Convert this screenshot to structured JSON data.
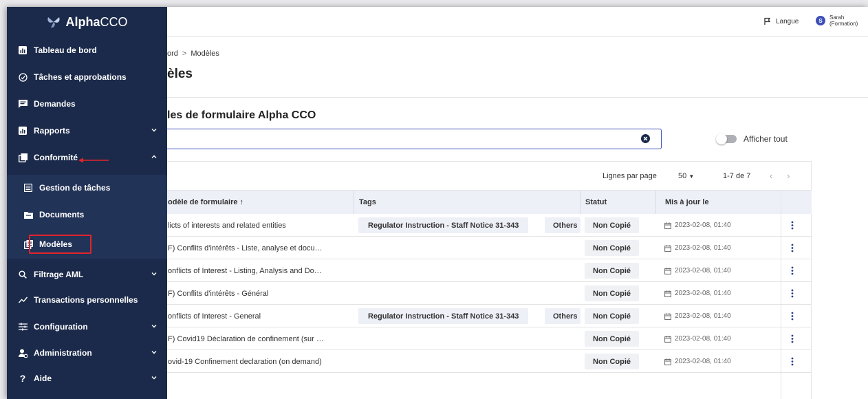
{
  "app": {
    "logo_bold": "Alpha",
    "logo_light": "CCO"
  },
  "header": {
    "language_label": "Langue",
    "user_initial": "S",
    "user_name_line1": "Sarah",
    "user_name_line2": "(Formation)"
  },
  "sidebar": {
    "items": [
      {
        "label": "Tableau de bord",
        "icon": "bar-chart-icon"
      },
      {
        "label": "Tâches et approbations",
        "icon": "check-circle-icon"
      },
      {
        "label": "Demandes",
        "icon": "message-icon"
      },
      {
        "label": "Rapports",
        "icon": "bar-chart-icon",
        "expandable": true
      },
      {
        "label": "Conformité",
        "icon": "copy-icon",
        "expanded": true
      },
      {
        "label": "Gestion de tâches",
        "icon": "list-icon"
      },
      {
        "label": "Documents",
        "icon": "folder-icon"
      },
      {
        "label": "Modèles",
        "icon": "template-icon",
        "active": true
      },
      {
        "label": "Filtrage AML",
        "icon": "search-icon",
        "expandable": true
      },
      {
        "label": "Transactions personnelles",
        "icon": "trend-icon"
      },
      {
        "label": "Configuration",
        "icon": "sliders-icon",
        "expandable": true
      },
      {
        "label": "Administration",
        "icon": "user-gear-icon",
        "expandable": true
      },
      {
        "label": "Aide",
        "icon": "question-icon",
        "expandable": true
      }
    ]
  },
  "breadcrumb": {
    "parent": "ord",
    "separator": ">",
    "current": "Modèles"
  },
  "page": {
    "title": "èles",
    "section_title": "les de formulaire Alpha CCO"
  },
  "search": {
    "value": "",
    "placeholder": ""
  },
  "toggle": {
    "label": "Afficher tout",
    "on": false
  },
  "pager": {
    "rows_per_page_label": "Lignes par page",
    "rows_per_page_value": "50",
    "range": "1-7 de 7"
  },
  "table": {
    "headers": {
      "name": "odèle de formulaire ↑",
      "tags": "Tags",
      "status": "Statut",
      "updated": "Mis à jour le"
    },
    "rows": [
      {
        "name": "licts of interests and related entities",
        "tag": "Regulator Instruction - Staff Notice 31-343",
        "tag2": "Others",
        "status": "Non Copié",
        "date": "2023-02-08, 01:40"
      },
      {
        "name": "F) Conflits d'intérêts - Liste, analyse et docu…",
        "tag": "",
        "tag2": "",
        "status": "Non Copié",
        "date": "2023-02-08, 01:40"
      },
      {
        "name": "onflicts of Interest - Listing, Analysis and Do…",
        "tag": "",
        "tag2": "",
        "status": "Non Copié",
        "date": "2023-02-08, 01:40"
      },
      {
        "name": "F) Conflits d'intérêts - Général",
        "tag": "",
        "tag2": "",
        "status": "Non Copié",
        "date": "2023-02-08, 01:40"
      },
      {
        "name": "onflicts of Interest - General",
        "tag": "Regulator Instruction - Staff Notice 31-343",
        "tag2": "Others",
        "status": "Non Copié",
        "date": "2023-02-08, 01:40"
      },
      {
        "name": "F) Covid19 Déclaration de confinement (sur …",
        "tag": "",
        "tag2": "",
        "status": "Non Copié",
        "date": "2023-02-08, 01:40"
      },
      {
        "name": "ovid-19 Confinement declaration (on demand)",
        "tag": "",
        "tag2": "",
        "status": "Non Copié",
        "date": "2023-02-08, 01:40"
      }
    ]
  },
  "colors": {
    "sidebar": "#1b2a4a",
    "accent": "#3d4fb8",
    "highlight": "#e3242b"
  }
}
